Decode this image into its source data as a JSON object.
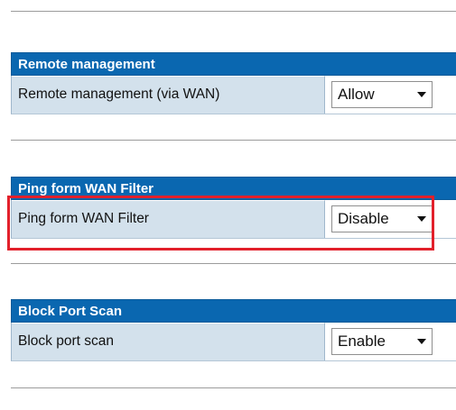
{
  "sections": [
    {
      "header": "Remote management",
      "row_label": "Remote management (via WAN)",
      "select_value": "Allow"
    },
    {
      "header": "Ping form WAN Filter",
      "row_label": "Ping form WAN Filter",
      "select_value": "Disable"
    },
    {
      "header": "Block Port Scan",
      "row_label": "Block port scan",
      "select_value": "Enable"
    }
  ],
  "highlight_color": "#e2202b",
  "header_color": "#0a67b0",
  "label_cell_color": "#d3e1ec"
}
